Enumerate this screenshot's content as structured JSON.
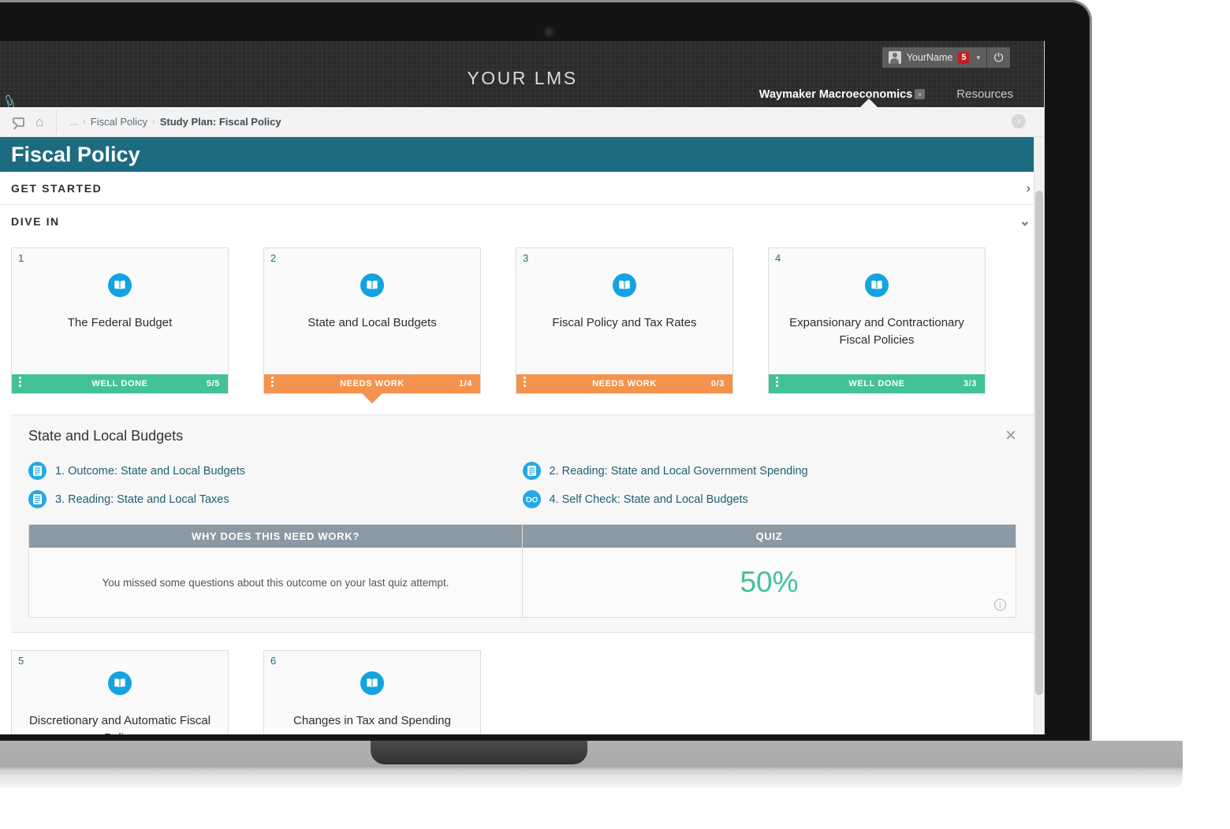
{
  "app": {
    "lms_title": "YOUR LMS",
    "paperclip_icon": "paperclip-icon",
    "user": {
      "name": "YourName",
      "notification_count": "5",
      "caret": "▾",
      "power_icon": "⏻"
    },
    "tabs": [
      {
        "label": "Waymaker Macroeconomics",
        "close": "×",
        "active": true
      },
      {
        "label": "Resources",
        "active": false
      }
    ]
  },
  "breadcrumb": {
    "home_icon": "⌂",
    "items": [
      "...",
      "Fiscal Policy",
      "Study Plan: Fiscal Policy"
    ],
    "separator": "›",
    "close_icon": "×"
  },
  "page": {
    "title": "Fiscal Policy",
    "accent_color": "#1c6b80",
    "sections": [
      {
        "label": "GET STARTED",
        "chevron": "›",
        "expanded": false
      },
      {
        "label": "DIVE IN",
        "chevron": "⌄",
        "expanded": true
      }
    ]
  },
  "cards_row1": [
    {
      "number": "1",
      "title": "The Federal Budget",
      "status": "WELL DONE",
      "score": "5/5",
      "state": "well",
      "icon": "book-icon"
    },
    {
      "number": "2",
      "title": "State and Local Budgets",
      "status": "NEEDS WORK",
      "score": "1/4",
      "state": "needs",
      "icon": "book-icon",
      "selected": true
    },
    {
      "number": "3",
      "title": "Fiscal Policy and Tax Rates",
      "status": "NEEDS WORK",
      "score": "0/3",
      "state": "needs",
      "icon": "book-icon"
    },
    {
      "number": "4",
      "title": "Expansionary and Contractionary Fiscal Policies",
      "status": "WELL DONE",
      "score": "3/3",
      "state": "well",
      "icon": "book-icon"
    }
  ],
  "cards_row2": [
    {
      "number": "5",
      "title": "Discretionary and Automatic Fiscal Policy",
      "status": "",
      "score": "",
      "state": "well",
      "icon": "book-icon"
    },
    {
      "number": "6",
      "title": "Changes in Tax and Spending",
      "status": "",
      "score": "",
      "state": "well",
      "icon": "book-icon"
    }
  ],
  "detail": {
    "title": "State and Local Budgets",
    "close_icon": "×",
    "items": [
      {
        "text": "1. Outcome: State and Local Budgets",
        "icon": "document-icon"
      },
      {
        "text": "2. Reading: State and Local Government Spending",
        "icon": "document-icon"
      },
      {
        "text": "3. Reading: State and Local Taxes",
        "icon": "document-icon"
      },
      {
        "text": "4. Self Check: State and Local Budgets",
        "icon": "glasses-icon"
      }
    ],
    "table": {
      "left_header": "WHY DOES THIS NEED WORK?",
      "right_header": "QUIZ",
      "left_text": "You missed some questions about this outcome on your last quiz attempt.",
      "quiz_score": "50%",
      "quiz_score_color": "#42c295",
      "info_icon": "ⓘ"
    }
  },
  "colors": {
    "well_done": "#42c295",
    "needs_work": "#f4934f",
    "header_teal": "#1c6b80",
    "icon_blue": "#13a3e0",
    "table_header": "#8b99a4"
  }
}
